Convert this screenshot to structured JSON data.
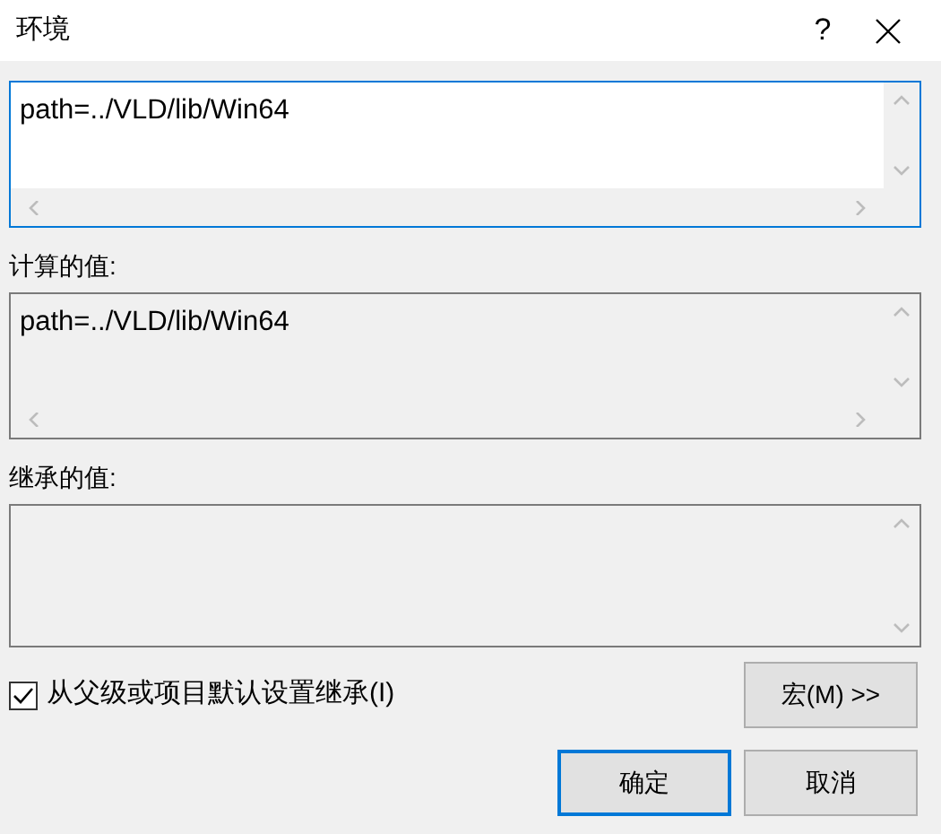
{
  "window": {
    "title": "环境",
    "help": "?"
  },
  "fields": [
    {
      "value": "path=../VLD/lib/Win64",
      "editable": true,
      "focused": true,
      "horizontal_scroll": true
    },
    {
      "label": "计算的值:",
      "value": "path=../VLD/lib/Win64",
      "editable": false,
      "focused": false,
      "horizontal_scroll": true
    },
    {
      "label": "继承的值:",
      "editable": false,
      "focused": false,
      "horizontal_scroll": false
    }
  ],
  "inherit": {
    "label": "从父级或项目默认设置继承(I)",
    "checked": true
  },
  "macro_button": "宏(M) >>",
  "buttons": [
    {
      "label": "确定",
      "default": true
    },
    {
      "label": "取消",
      "default": false
    }
  ]
}
